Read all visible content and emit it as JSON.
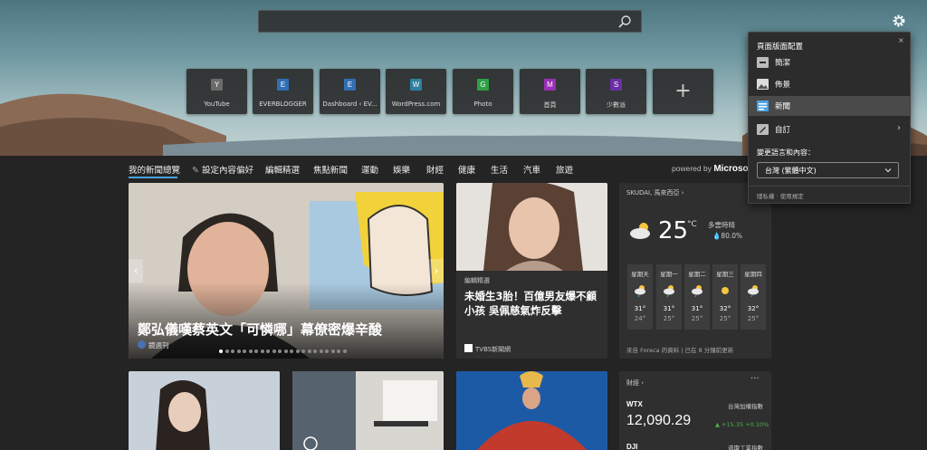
{
  "search": {
    "placeholder": ""
  },
  "quick_links": [
    {
      "letter": "Y",
      "label": "YouTube",
      "color": "#6b6b6b"
    },
    {
      "letter": "E",
      "label": "EVERBLOGGER",
      "color": "#2f6fb5"
    },
    {
      "letter": "E",
      "label": "Dashboard ‹ EV...",
      "color": "#2f6fb5"
    },
    {
      "letter": "W",
      "label": "WordPress.com",
      "color": "#2f7fa0"
    },
    {
      "letter": "G",
      "label": "Photo",
      "color": "#2ea043"
    },
    {
      "letter": "M",
      "label": "首頁",
      "color": "#9a2fb5"
    },
    {
      "letter": "S",
      "label": "少數派",
      "color": "#6b2fa5"
    }
  ],
  "nav": {
    "items": [
      "我的新聞總覽",
      "設定內容偏好",
      "編輯精選",
      "焦點新聞",
      "運動",
      "娛樂",
      "財經",
      "健康",
      "生活",
      "汽車",
      "旅遊"
    ],
    "powered_by": "powered by",
    "brand": "Microsoft"
  },
  "hero": {
    "title": "鄭弘儀嘆蔡英文「可憐哪」幕僚密爆辛酸",
    "source": "鏡週刊",
    "prev": "‹",
    "next": "›"
  },
  "story": {
    "tag": "編輯精選",
    "title": "未婚生3胎！百億男友爆不顧小孩 吳佩慈氣炸反擊",
    "source": "TVBS新聞網"
  },
  "weather": {
    "location": "SKUDAI, 馬來西亞",
    "temp": "25",
    "unit": "°C",
    "condition": "多雲時晴",
    "humidity": "80.0%",
    "days": [
      {
        "name": "星期天",
        "hi": "31°",
        "lo": "24°",
        "icon": "cloud-sun-rain"
      },
      {
        "name": "星期一",
        "hi": "31°",
        "lo": "25°",
        "icon": "cloud-sun-rain"
      },
      {
        "name": "星期二",
        "hi": "31°",
        "lo": "25°",
        "icon": "cloud-sun-rain"
      },
      {
        "name": "星期三",
        "hi": "32°",
        "lo": "25°",
        "icon": "sun"
      },
      {
        "name": "星期四",
        "hi": "32°",
        "lo": "25°",
        "icon": "cloud-sun-rain"
      }
    ],
    "footer": "來自 Foreca 的資料 | 已在 8 分鐘前更新"
  },
  "finance": {
    "title": "財經",
    "more": "···",
    "symbol": "WTX",
    "name": "台灣加權指數",
    "value": "12,090.29",
    "change": "+15.35 +0.10%",
    "symbol2": "DJI",
    "name2": "道瓊工業指數"
  },
  "panel": {
    "title": "頁面版面配置",
    "close": "×",
    "options": [
      {
        "label": "簡潔",
        "icon": "minus-icon"
      },
      {
        "label": "佈景",
        "icon": "image-icon"
      },
      {
        "label": "新聞",
        "icon": "news-icon"
      },
      {
        "label": "自訂",
        "icon": "pencil-icon"
      }
    ],
    "chevron": "›",
    "lang_label": "變更語言和內容：",
    "lang_value": "台灣 (繁體中文)",
    "footer": "隱私權 · 使用規定"
  },
  "colors": {
    "accent": "#4ca3e0",
    "panel_bg": "#2c2c2c",
    "feed_bg": "#242424"
  }
}
